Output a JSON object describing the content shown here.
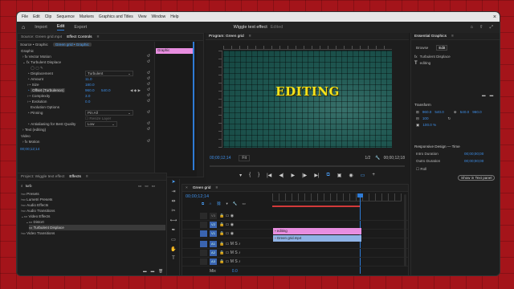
{
  "menu": {
    "items": [
      "File",
      "Edit",
      "Clip",
      "Sequence",
      "Markers",
      "Graphics and Titles",
      "View",
      "Window",
      "Help"
    ],
    "close": "×"
  },
  "workspace": {
    "tabs": [
      "Import",
      "Edit",
      "Export"
    ],
    "project_title": "Wiggle text effect",
    "edited": "Edited"
  },
  "effect_controls": {
    "tabs": [
      "Source: Green grid.mp4",
      "Effect Controls",
      "≡"
    ],
    "master": "Source • Graphic",
    "sequence_chip": "Green grid • Graphic",
    "chip_label": "Graphic",
    "time_start": "00:00",
    "time_end": "00;00;08;00",
    "section_graphic": "Graphic",
    "vector_motion": "Vector Motion",
    "turbulent_displace": "Turbulent Displace",
    "displacement_label": "Displacement",
    "displacement_value": "Turbulent",
    "amount_label": "Amount",
    "amount_value": "11.0",
    "size_label": "Size",
    "size_value": "180.0",
    "offset_label": "Offset (Turbulence)",
    "offset_x": "960.0",
    "offset_y": "540.0",
    "complexity_label": "Complexity",
    "complexity_value": "3.0",
    "evolution_label": "Evolution",
    "evolution_value": "0.0",
    "evolution_options": "Evolution Options",
    "pinning_label": "Pinning",
    "pinning_value": "Pin All",
    "resize_layer": "Resize Layer",
    "antialias_label": "Antialiasing for Best Quality",
    "antialias_value": "Low",
    "text_layer": "Text (editing)",
    "video_label": "Video",
    "motion_label": "Motion",
    "timecode": "00;00;12;14"
  },
  "program": {
    "tab": "Program: Green grid",
    "title_text": "EDITING",
    "timecode": "00;00;12;14",
    "fit": "Fit",
    "scale": "1/2",
    "duration": "00;00;12;18"
  },
  "essential_graphics": {
    "tab": "Essential Graphics",
    "subtabs": [
      "Browse",
      "Edit"
    ],
    "layers": [
      "Turbulent Displace",
      "editing"
    ],
    "transform": "Transform",
    "pos_x": "960.0",
    "pos_y": "540.0",
    "rot_x": "540.0",
    "rot_y": "960.0",
    "scale_value": "100",
    "opacity": "100.0 %",
    "responsive": "Responsive Design — Time",
    "intro_label": "Intro Duration",
    "intro_value": "00;00;00;00",
    "outro_label": "Outro Duration",
    "outro_value": "00;00;00;00",
    "roll": "Roll",
    "show_in_text_panel": "Show in Text panel"
  },
  "project": {
    "tabs": [
      "Project: Wiggle text effect",
      "Effects",
      "≡"
    ],
    "search_value": "turb",
    "tree": [
      "Presets",
      "Lumetri Presets",
      "Audio Effects",
      "Audio Transitions",
      "Video Effects",
      "Distort",
      "Turbulent Displace",
      "Video Transitions"
    ]
  },
  "timeline": {
    "tab": "Green grid",
    "timecode": "00;00;12;14",
    "tracks_v": [
      "V3",
      "V2",
      "V1"
    ],
    "tracks_a": [
      "A1",
      "A2",
      "A3"
    ],
    "mix": "Mix",
    "mix_value": "0.0",
    "clip_top": "editing",
    "clip_bottom": "Green grid.mp4"
  }
}
